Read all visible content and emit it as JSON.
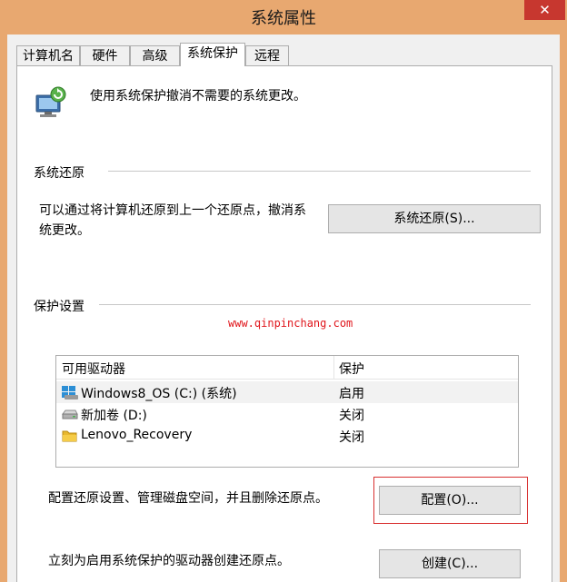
{
  "window": {
    "title": "系统属性",
    "close_label": "✕"
  },
  "tabs": [
    {
      "label": "计算机名"
    },
    {
      "label": "硬件"
    },
    {
      "label": "高级"
    },
    {
      "label": "系统保护",
      "active": true
    },
    {
      "label": "远程"
    }
  ],
  "intro": {
    "text": "使用系统保护撤消不需要的系统更改。",
    "icon": "system-protection-icon"
  },
  "restore": {
    "group_label": "系统还原",
    "description_line1": "可以通过将计算机还原到上一个还原点，撤消系",
    "description_line2": "统更改。",
    "button_label": "系统还原(S)..."
  },
  "watermark": "www.qinpinchang.com",
  "protection": {
    "group_label": "保护设置",
    "columns": [
      "可用驱动器",
      "保护"
    ],
    "drives": [
      {
        "name": "Windows8_OS (C:) (系统)",
        "protection": "启用",
        "icon": "system-drive-icon"
      },
      {
        "name": "新加卷 (D:)",
        "protection": "关闭",
        "icon": "disk-drive-icon"
      },
      {
        "name": "Lenovo_Recovery",
        "protection": "关闭",
        "icon": "folder-icon"
      }
    ],
    "configure_text": "配置还原设置、管理磁盘空间，并且删除还原点。",
    "configure_button": "配置(O)...",
    "create_text": "立刻为启用系统保护的驱动器创建还原点。",
    "create_button": "创建(C)..."
  },
  "colors": {
    "title_bar": "#e8a870",
    "close_button": "#c7372f",
    "highlight_border": "#d83030",
    "watermark": "#e0161c"
  }
}
